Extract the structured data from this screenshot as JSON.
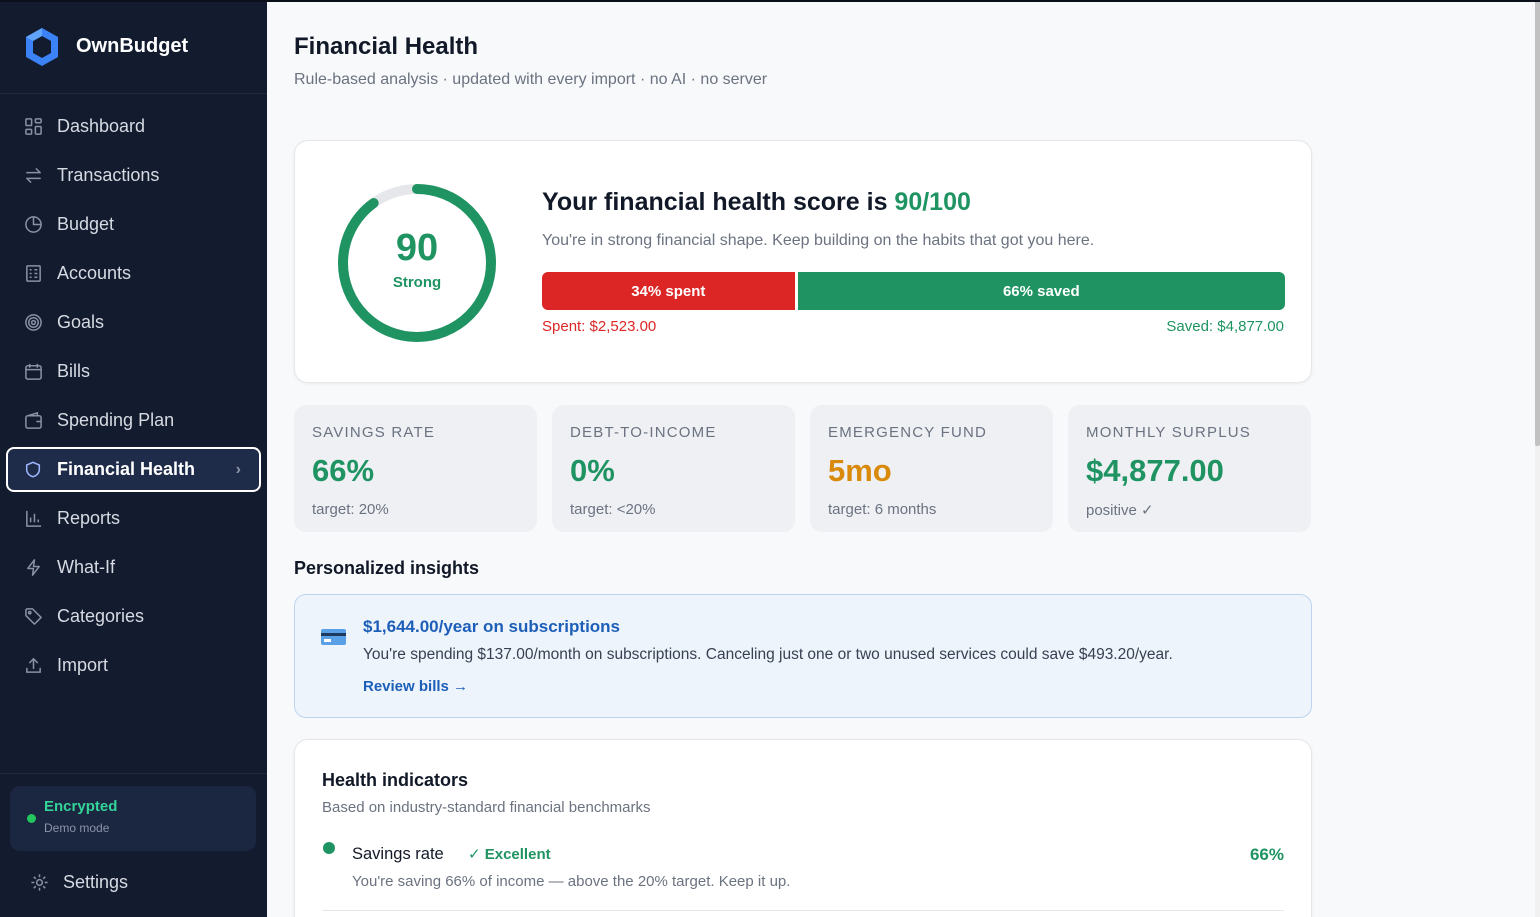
{
  "app": {
    "name": "OwnBudget"
  },
  "sidebar": {
    "items": [
      {
        "label": "Dashboard",
        "icon": "grid-icon"
      },
      {
        "label": "Transactions",
        "icon": "arrows-icon"
      },
      {
        "label": "Budget",
        "icon": "pie-icon"
      },
      {
        "label": "Accounts",
        "icon": "bank-icon"
      },
      {
        "label": "Goals",
        "icon": "target-icon"
      },
      {
        "label": "Bills",
        "icon": "calendar-icon"
      },
      {
        "label": "Spending Plan",
        "icon": "wallet-icon"
      },
      {
        "label": "Financial Health",
        "icon": "shield-icon",
        "active": true
      },
      {
        "label": "Reports",
        "icon": "bar-chart-icon"
      },
      {
        "label": "What-If",
        "icon": "lightning-icon"
      },
      {
        "label": "Categories",
        "icon": "tag-icon"
      },
      {
        "label": "Import",
        "icon": "upload-icon"
      }
    ],
    "status": {
      "title": "Encrypted",
      "subtitle": "Demo mode"
    },
    "settings_label": "Settings"
  },
  "page": {
    "title": "Financial Health",
    "subtitle": "Rule-based analysis · updated with every import · no AI · no server"
  },
  "score": {
    "value": "90",
    "max": 100,
    "fraction": 0.9,
    "rating": "Strong",
    "headline_prefix": "Your financial health score is ",
    "headline_value": "90/100",
    "description": "You're in strong financial shape. Keep building on the habits that got you here.",
    "spent_pct": 34,
    "spent_bar_label": "34% spent",
    "saved_bar_label": "66% saved",
    "spent_label": "Spent: $2,523.00",
    "saved_label": "Saved: $4,877.00"
  },
  "kpis": [
    {
      "label": "Savings rate",
      "value": "66%",
      "target": "target: 20%",
      "tone": "green"
    },
    {
      "label": "Debt-to-income",
      "value": "0%",
      "target": "target: <20%",
      "tone": "green"
    },
    {
      "label": "Emergency fund",
      "value": "5mo",
      "target": "target: 6 months",
      "tone": "amber"
    },
    {
      "label": "Monthly surplus",
      "value": "$4,877.00",
      "target": "positive ✓",
      "tone": "green"
    }
  ],
  "insights": {
    "section_title": "Personalized insights",
    "items": [
      {
        "icon": "credit-card-icon",
        "title": "$1,644.00/year on subscriptions",
        "text": "You're spending $137.00/month on subscriptions. Canceling just one or two unused services could save $493.20/year.",
        "link": "Review bills →"
      }
    ]
  },
  "health_indicators": {
    "title": "Health indicators",
    "subtitle": "Based on industry-standard financial benchmarks",
    "rows": [
      {
        "name": "Savings rate",
        "badge": "✓ Excellent",
        "value": "66%",
        "description": "You're saving 66% of income — above the 20% target. Keep it up."
      }
    ]
  },
  "colors": {
    "accent": "#1f9462",
    "danger": "#dc2626",
    "warning": "#d98a0b",
    "sidebar": "#131b2f",
    "link": "#1d5fb8"
  }
}
